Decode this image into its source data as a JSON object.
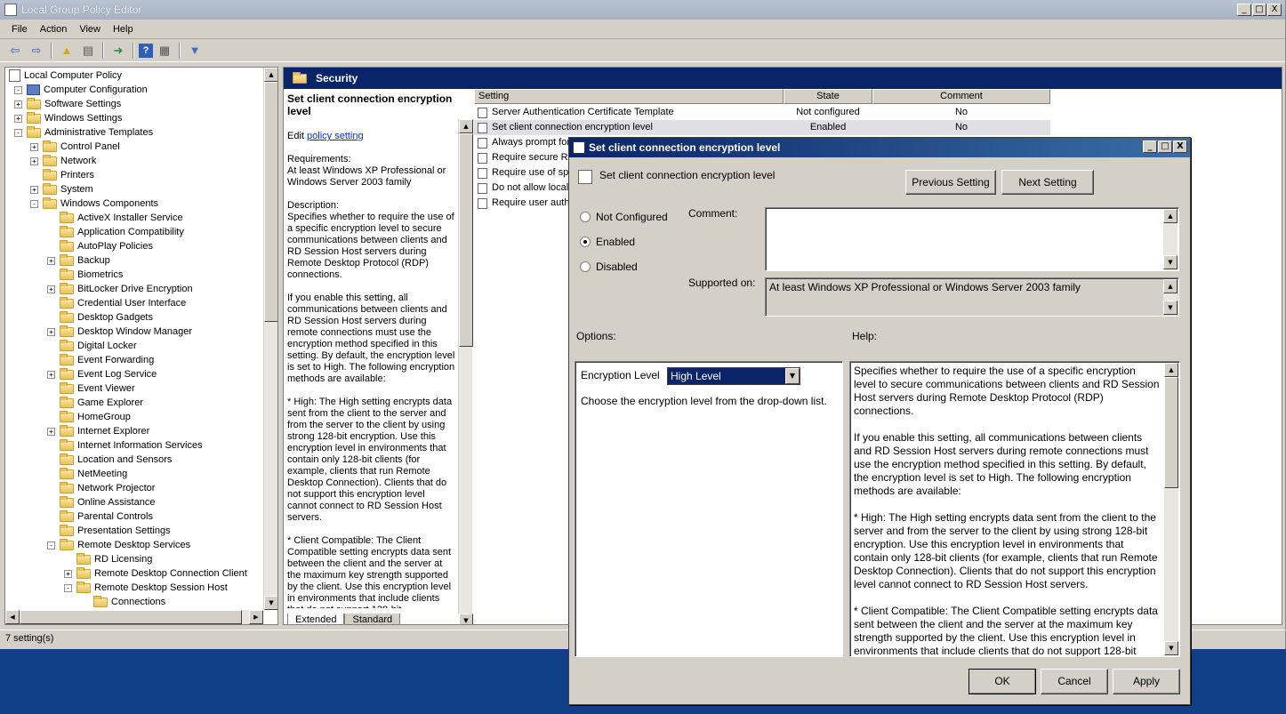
{
  "window": {
    "title": "Local Group Policy Editor",
    "controls": [
      "_",
      "□",
      "X"
    ]
  },
  "menu": [
    "File",
    "Action",
    "View",
    "Help"
  ],
  "toolbar_icons": [
    "back-icon",
    "forward-icon",
    "up-folder-icon",
    "show-hide-tree-icon",
    "export-list-icon",
    "help-icon",
    "properties-icon",
    "filter-icon"
  ],
  "tree": [
    {
      "label": "Local Computer Policy",
      "level": 0,
      "exp": "",
      "icon": "policy"
    },
    {
      "label": "Computer Configuration",
      "level": 0,
      "exp": "-",
      "icon": "pc"
    },
    {
      "label": "Software Settings",
      "level": 1,
      "exp": "+",
      "icon": "folder"
    },
    {
      "label": "Windows Settings",
      "level": 1,
      "exp": "+",
      "icon": "folder"
    },
    {
      "label": "Administrative Templates",
      "level": 1,
      "exp": "-",
      "icon": "folder"
    },
    {
      "label": "Control Panel",
      "level": 2,
      "exp": "+",
      "icon": "folder"
    },
    {
      "label": "Network",
      "level": 2,
      "exp": "+",
      "icon": "folder"
    },
    {
      "label": "Printers",
      "level": 2,
      "exp": "",
      "icon": "folder"
    },
    {
      "label": "System",
      "level": 2,
      "exp": "+",
      "icon": "folder"
    },
    {
      "label": "Windows Components",
      "level": 2,
      "exp": "-",
      "icon": "folder"
    },
    {
      "label": "ActiveX Installer Service",
      "level": 3,
      "exp": "",
      "icon": "folder"
    },
    {
      "label": "Application Compatibility",
      "level": 3,
      "exp": "",
      "icon": "folder"
    },
    {
      "label": "AutoPlay Policies",
      "level": 3,
      "exp": "",
      "icon": "folder"
    },
    {
      "label": "Backup",
      "level": 3,
      "exp": "+",
      "icon": "folder"
    },
    {
      "label": "Biometrics",
      "level": 3,
      "exp": "",
      "icon": "folder"
    },
    {
      "label": "BitLocker Drive Encryption",
      "level": 3,
      "exp": "+",
      "icon": "folder"
    },
    {
      "label": "Credential User Interface",
      "level": 3,
      "exp": "",
      "icon": "folder"
    },
    {
      "label": "Desktop Gadgets",
      "level": 3,
      "exp": "",
      "icon": "folder"
    },
    {
      "label": "Desktop Window Manager",
      "level": 3,
      "exp": "+",
      "icon": "folder"
    },
    {
      "label": "Digital Locker",
      "level": 3,
      "exp": "",
      "icon": "folder"
    },
    {
      "label": "Event Forwarding",
      "level": 3,
      "exp": "",
      "icon": "folder"
    },
    {
      "label": "Event Log Service",
      "level": 3,
      "exp": "+",
      "icon": "folder"
    },
    {
      "label": "Event Viewer",
      "level": 3,
      "exp": "",
      "icon": "folder"
    },
    {
      "label": "Game Explorer",
      "level": 3,
      "exp": "",
      "icon": "folder"
    },
    {
      "label": "HomeGroup",
      "level": 3,
      "exp": "",
      "icon": "folder"
    },
    {
      "label": "Internet Explorer",
      "level": 3,
      "exp": "+",
      "icon": "folder"
    },
    {
      "label": "Internet Information Services",
      "level": 3,
      "exp": "",
      "icon": "folder"
    },
    {
      "label": "Location and Sensors",
      "level": 3,
      "exp": "",
      "icon": "folder"
    },
    {
      "label": "NetMeeting",
      "level": 3,
      "exp": "",
      "icon": "folder"
    },
    {
      "label": "Network Projector",
      "level": 3,
      "exp": "",
      "icon": "folder"
    },
    {
      "label": "Online Assistance",
      "level": 3,
      "exp": "",
      "icon": "folder"
    },
    {
      "label": "Parental Controls",
      "level": 3,
      "exp": "",
      "icon": "folder"
    },
    {
      "label": "Presentation Settings",
      "level": 3,
      "exp": "",
      "icon": "folder"
    },
    {
      "label": "Remote Desktop Services",
      "level": 3,
      "exp": "-",
      "icon": "folder"
    },
    {
      "label": "RD Licensing",
      "level": 4,
      "exp": "",
      "icon": "folder"
    },
    {
      "label": "Remote Desktop Connection Client",
      "level": 4,
      "exp": "+",
      "icon": "folder"
    },
    {
      "label": "Remote Desktop Session Host",
      "level": 4,
      "exp": "-",
      "icon": "folder"
    },
    {
      "label": "Connections",
      "level": 5,
      "exp": "",
      "icon": "folder"
    }
  ],
  "right": {
    "header": "Security",
    "desc_title": "Set client connection encryption level",
    "edit_prefix": "Edit ",
    "edit_link": "policy setting ",
    "desc_paragraphs": [
      "Requirements:\nAt least Windows XP Professional or Windows Server 2003 family",
      "Description:\nSpecifies whether to require the use of a specific encryption level to secure communications between clients and RD Session Host servers during Remote Desktop Protocol (RDP) connections.",
      "If you enable this setting, all communications between clients and RD Session Host servers during remote connections must use the encryption method specified in this setting. By default, the encryption level is set to High. The following encryption methods are available:",
      "* High: The High setting encrypts data sent from the client to the server and from the server to the client by using strong 128-bit encryption. Use this encryption level in environments that contain only 128-bit clients (for example, clients that run Remote Desktop Connection). Clients that do not support this encryption level cannot connect to RD Session Host servers.",
      "* Client Compatible: The Client Compatible setting encrypts data sent between the client and the server at the maximum key strength supported by the client. Use this encryption level in environments that include clients that do not support 128-bit"
    ],
    "tabs": [
      "Extended",
      "Standard"
    ],
    "columns": [
      "Setting",
      "State",
      "Comment"
    ],
    "rows": [
      {
        "setting": "Server Authentication Certificate Template",
        "state": "Not configured",
        "comment": "No"
      },
      {
        "setting": "Set client connection encryption level",
        "state": "Enabled",
        "comment": "No"
      },
      {
        "setting": "Always prompt for",
        "state": "",
        "comment": ""
      },
      {
        "setting": "Require secure RP",
        "state": "",
        "comment": ""
      },
      {
        "setting": "Require use of spe",
        "state": "",
        "comment": ""
      },
      {
        "setting": "Do not allow local",
        "state": "",
        "comment": ""
      },
      {
        "setting": "Require user auth",
        "state": "",
        "comment": ""
      }
    ]
  },
  "status": "7 setting(s)",
  "dialog": {
    "title": "Set client connection encryption level",
    "heading": "Set client connection encryption level",
    "prev": "Previous Setting",
    "next": "Next Setting",
    "radios": [
      {
        "label": "Not Configured",
        "checked": false
      },
      {
        "label": "Enabled",
        "checked": true
      },
      {
        "label": "Disabled",
        "checked": false
      }
    ],
    "comment_label": "Comment:",
    "supported_label": "Supported on:",
    "supported_value": "At least Windows XP Professional or Windows Server 2003 family",
    "options_label": "Options:",
    "help_label": "Help:",
    "enc_label": "Encryption Level",
    "enc_value": "High Level",
    "enc_hint": "Choose the encryption level from the drop-down list.",
    "help_text": "Specifies whether to require the use of a specific encryption level to secure communications between clients and RD Session Host servers during Remote Desktop Protocol (RDP) connections.\n\nIf you enable this setting, all communications between clients and RD Session Host servers during remote connections must use the encryption method specified in this setting. By default, the encryption level is set to High. The following encryption methods are available:\n\n* High: The High setting encrypts data sent from the client to the server and from the server to the client by using strong 128-bit encryption. Use this encryption level in environments that contain only 128-bit clients (for example, clients that run Remote Desktop Connection). Clients that do not support this encryption level cannot connect to RD Session Host servers.\n\n* Client Compatible: The Client Compatible setting encrypts data sent between the client and the server at the maximum key strength supported by the client. Use this encryption level in environments that include clients that do not support 128-bit",
    "ok": "OK",
    "cancel": "Cancel",
    "apply": "Apply"
  }
}
